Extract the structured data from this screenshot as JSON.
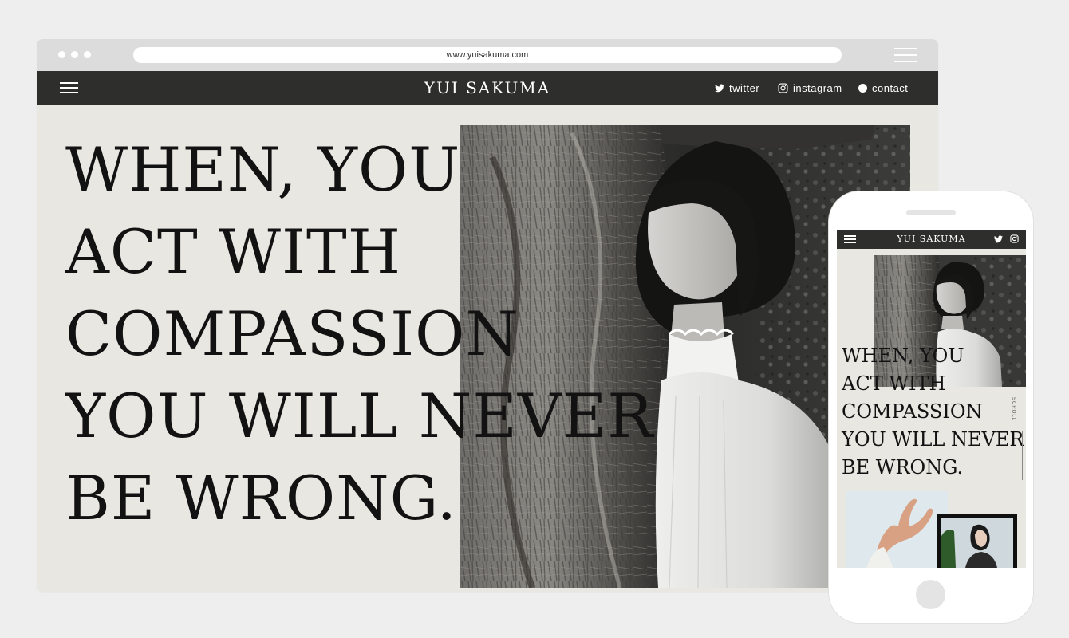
{
  "browser": {
    "url": "www.yuisakuma.com"
  },
  "site": {
    "logo": "YUI SAKUMA",
    "nav": [
      {
        "label": "twitter",
        "icon": "twitter-icon"
      },
      {
        "label": "instagram",
        "icon": "instagram-icon"
      },
      {
        "label": "contact",
        "icon": "contact-dot-icon"
      }
    ],
    "hero_quote_lines": [
      "WHEN, YOU",
      "ACT WITH",
      "COMPASSION",
      "YOU WILL NEVER",
      "BE WRONG."
    ]
  },
  "mobile": {
    "logo": "YUI SAKUMA",
    "quote_lines": [
      "WHEN, YOU",
      "ACT WITH",
      "COMPASSION",
      "YOU WILL NEVER",
      "BE WRONG."
    ],
    "scroll_label": "SCROLL"
  },
  "colors": {
    "page_bg": "#eeeeee",
    "site_bg": "#e9e7e1",
    "header_bg": "#2e2e2c",
    "text": "#121212"
  }
}
